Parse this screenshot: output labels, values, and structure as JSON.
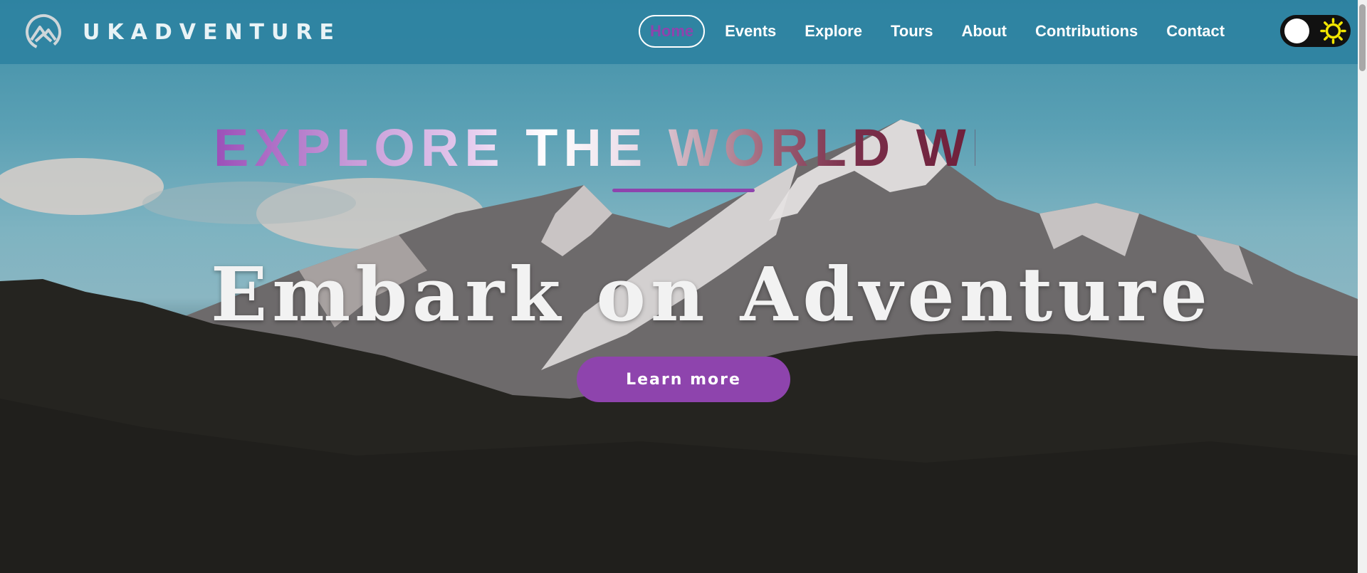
{
  "brand": {
    "name": "UKADVENTURE",
    "logo_icon": "mountain-circle-icon"
  },
  "nav": {
    "items": [
      {
        "label": "Home",
        "active": true
      },
      {
        "label": "Events"
      },
      {
        "label": "Explore"
      },
      {
        "label": "Tours"
      },
      {
        "label": "About"
      },
      {
        "label": "Contributions"
      },
      {
        "label": "Contact"
      }
    ]
  },
  "theme_toggle": {
    "state": "light",
    "icon": "sun-icon"
  },
  "hero": {
    "kicker": "EXPLORE THE WORLD WI",
    "headline": "Embark on Adventure",
    "cta_label": "Learn more"
  },
  "colors": {
    "accent": "#8e44ad",
    "navbar": "#2c82a0",
    "toggle_bg": "#111111",
    "sun": "#f2e600"
  }
}
